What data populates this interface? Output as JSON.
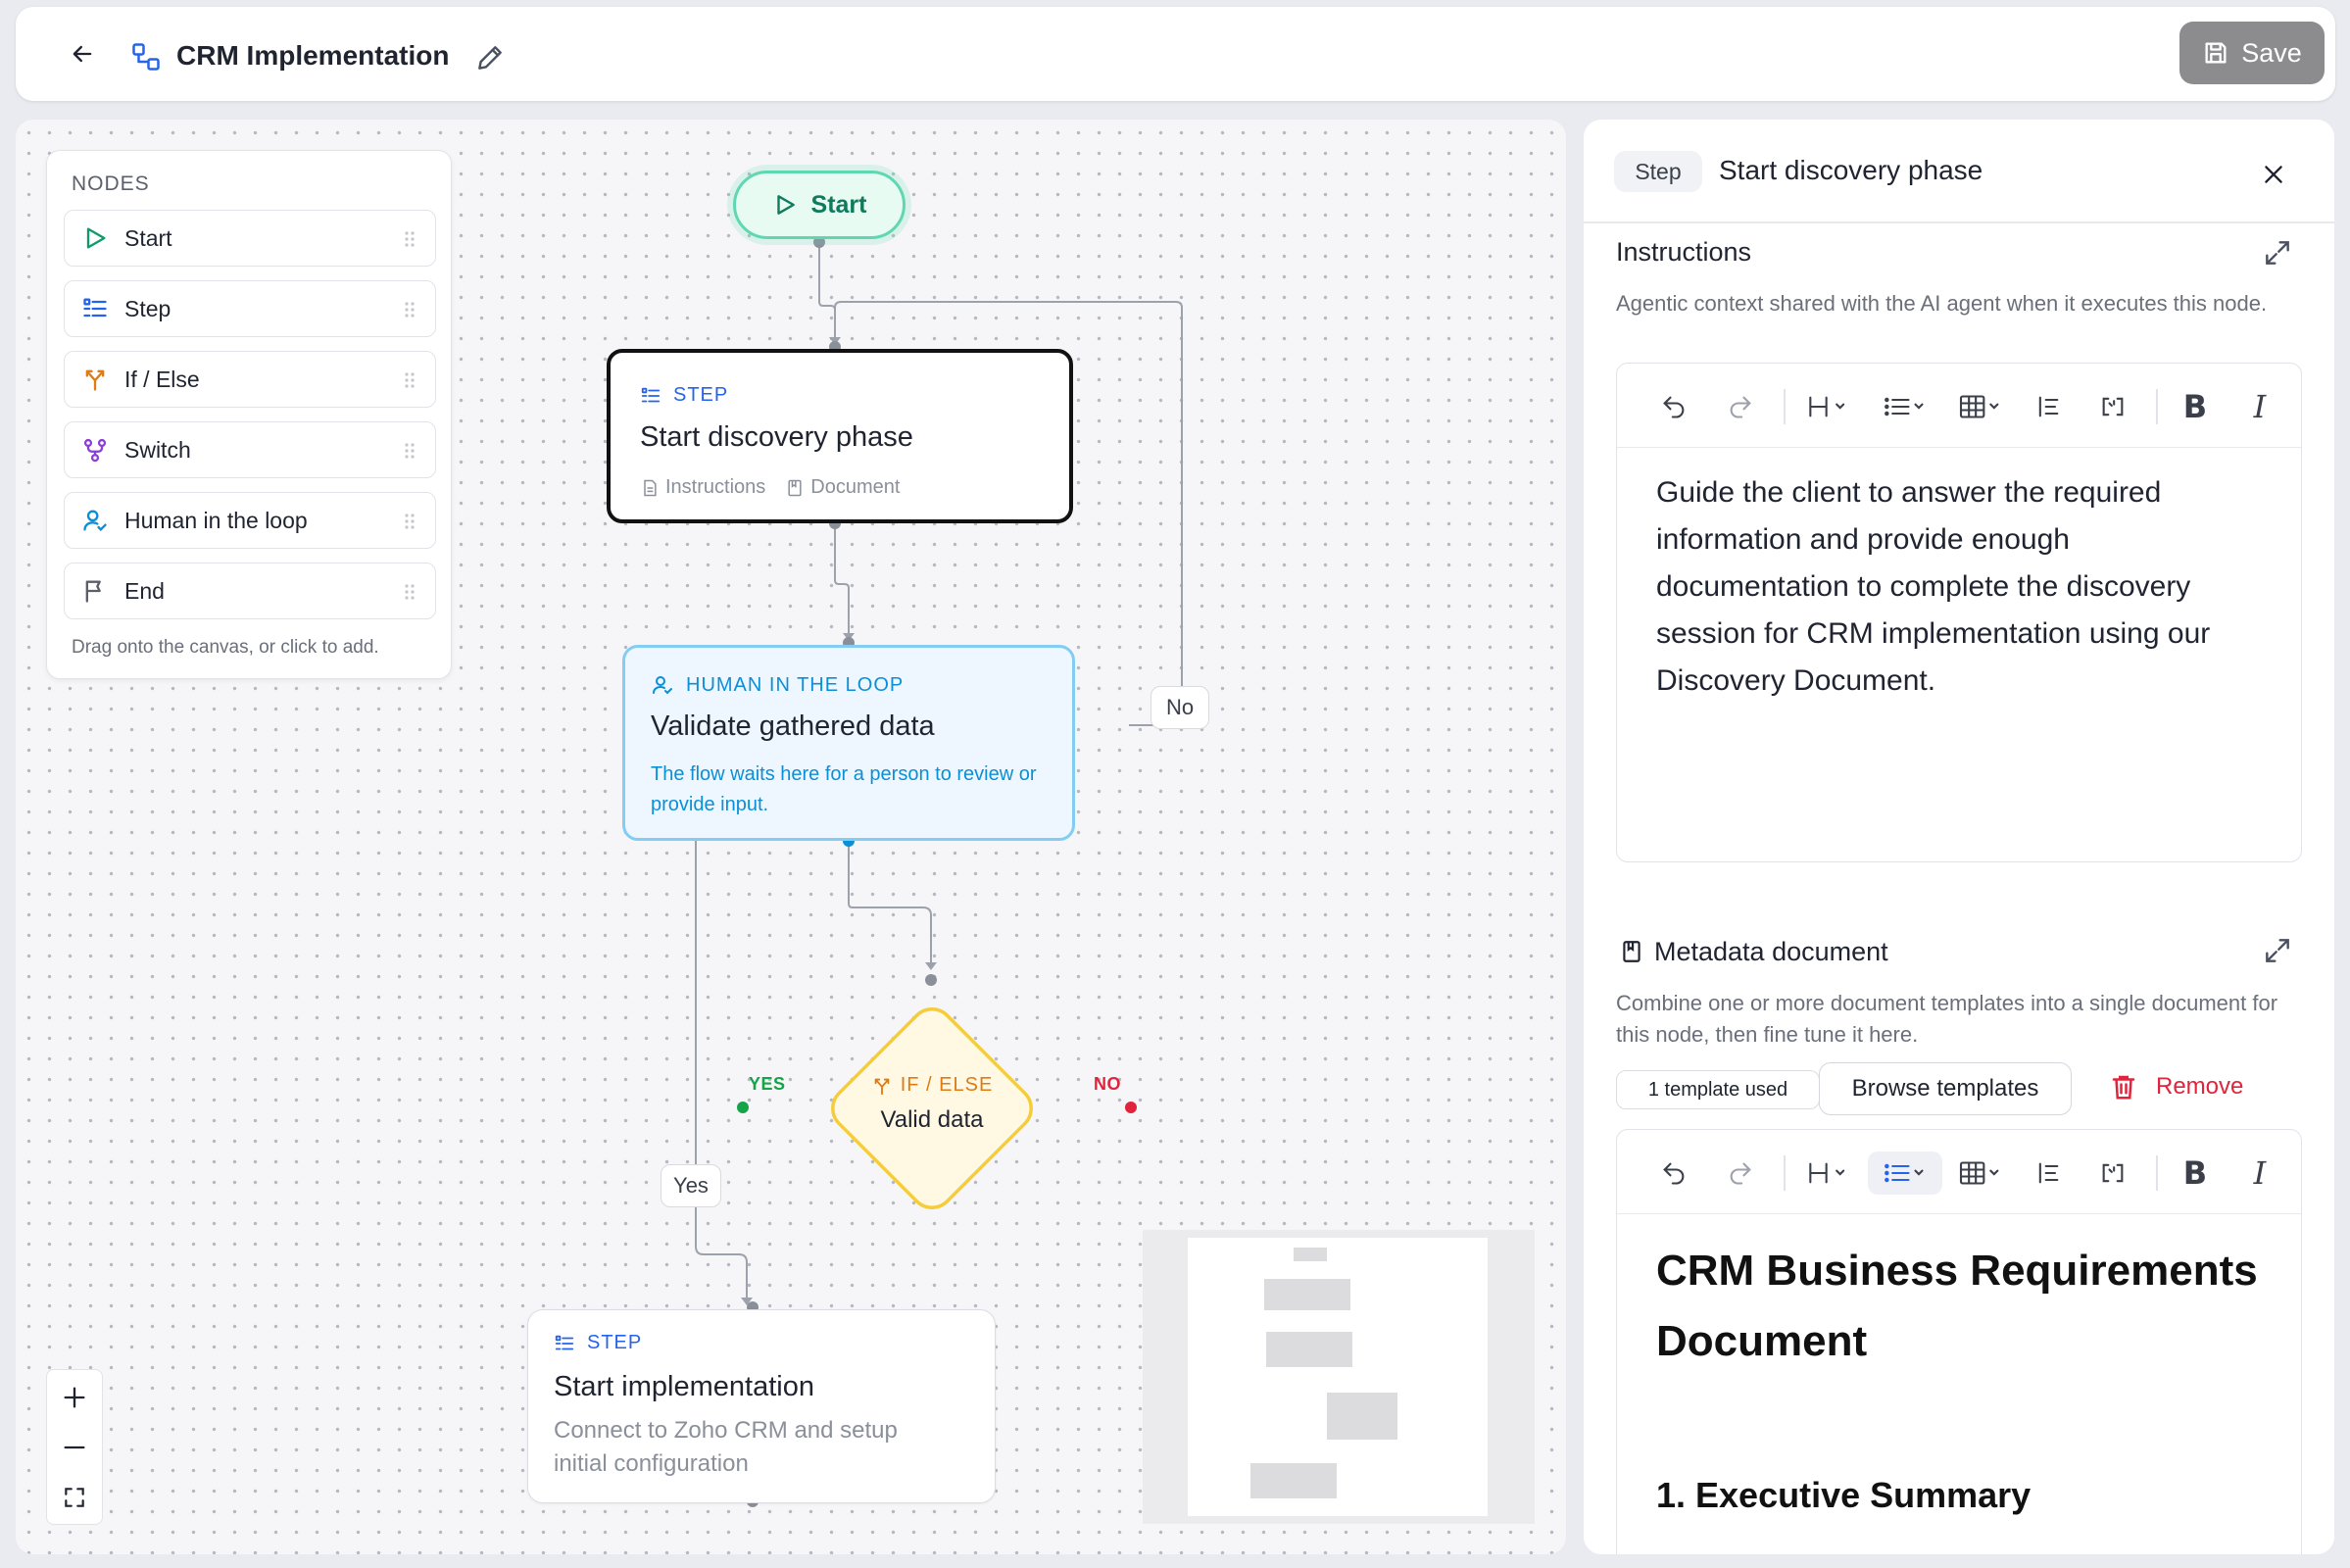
{
  "app": {
    "title": "CRM Implementation",
    "save_label": "Save"
  },
  "palette": {
    "heading": "NODES",
    "items": [
      {
        "label": "Start",
        "icon": "play-icon"
      },
      {
        "label": "Step",
        "icon": "list-icon"
      },
      {
        "label": "If / Else",
        "icon": "branch-icon"
      },
      {
        "label": "Switch",
        "icon": "switch-icon"
      },
      {
        "label": "Human in the loop",
        "icon": "person-icon"
      },
      {
        "label": "End",
        "icon": "flag-icon"
      }
    ],
    "hint": "Drag onto the canvas, or click to add."
  },
  "flow": {
    "start_label": "Start",
    "step1": {
      "tag": "STEP",
      "title": "Start discovery phase",
      "meta1": "Instructions",
      "meta2": "Document"
    },
    "human": {
      "tag": "HUMAN IN THE LOOP",
      "title": "Validate gathered data",
      "description": "The flow waits here for a person to review or provide input."
    },
    "decision": {
      "tag": "IF / ELSE",
      "title": "Valid data",
      "yes_port": "YES",
      "no_port": "NO"
    },
    "edge_yes": "Yes",
    "edge_no": "No",
    "step2": {
      "tag": "STEP",
      "title": "Start implementation",
      "description": "Connect to Zoho CRM and setup initial configuration"
    }
  },
  "panel": {
    "type_badge": "Step",
    "title": "Start discovery phase",
    "instructions": {
      "heading": "Instructions",
      "description": "Agentic context shared with the AI agent when it executes this node.",
      "content": "Guide the client to answer the required information and provide enough documentation to complete the discovery session for CRM implementation using our Discovery Document."
    },
    "metadata": {
      "heading": "Metadata document",
      "description": "Combine one or more document templates into a single document for this node, then fine tune it here.",
      "templates_chip": "1 template used",
      "browse_label": "Browse templates",
      "remove_label": "Remove",
      "doc_title": "CRM Business Requirements Document",
      "doc_section": "1. Executive Summary"
    }
  },
  "colors": {
    "accent_blue": "#2563eb",
    "start_green": "#0f7a5c",
    "human_blue": "#0b8fd6",
    "decision_orange": "#e07a12",
    "yes_green": "#16a34a",
    "no_red": "#e0243b"
  }
}
